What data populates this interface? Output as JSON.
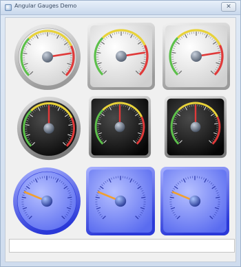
{
  "window": {
    "title": "Angular Gauges Demo",
    "close_glyph": "✕"
  },
  "gauges": [
    {
      "name": "gauge-round-light",
      "style": "round",
      "theme": "light",
      "needle_value": 0.8
    },
    {
      "name": "gauge-square-light-1",
      "style": "square",
      "theme": "light",
      "needle_value": 0.8
    },
    {
      "name": "gauge-square-light-2",
      "style": "square",
      "theme": "light",
      "needle_value": 0.8
    },
    {
      "name": "gauge-round-dark",
      "style": "round",
      "theme": "dark",
      "needle_value": 0.5
    },
    {
      "name": "gauge-square-dark-1",
      "style": "square",
      "theme": "dark",
      "needle_value": 0.5
    },
    {
      "name": "gauge-square-dark-2",
      "style": "square",
      "theme": "dark",
      "needle_value": 0.5
    },
    {
      "name": "gauge-round-blue",
      "style": "round",
      "theme": "blue",
      "needle_value": 0.25
    },
    {
      "name": "gauge-square-blue-1",
      "style": "square",
      "theme": "blue",
      "needle_value": 0.25
    },
    {
      "name": "gauge-square-blue-2",
      "style": "square",
      "theme": "blue",
      "needle_value": 0.25
    }
  ],
  "progress": {
    "value": 0
  },
  "colors": {
    "needle_light": "#e03a3a",
    "needle_blue": "#f0a030",
    "range_green": "#5cc04a",
    "range_yellow": "#e8d23a",
    "range_red": "#e03a3a"
  }
}
